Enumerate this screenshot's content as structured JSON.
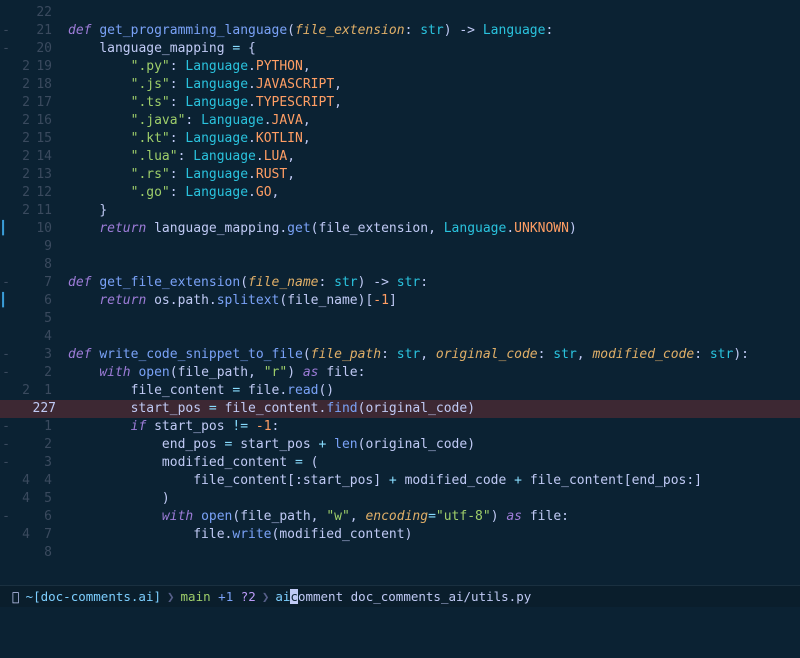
{
  "lines": [
    {
      "sign": "",
      "rel": "22",
      "abs": "",
      "tokens": []
    },
    {
      "sign": "-",
      "rel": "21",
      "abs": "",
      "tokens": [
        {
          "t": "kw",
          "v": "def "
        },
        {
          "t": "fnname",
          "v": "get_programming_language"
        },
        {
          "t": "punc",
          "v": "("
        },
        {
          "t": "param",
          "v": "file_extension"
        },
        {
          "t": "punc",
          "v": ": "
        },
        {
          "t": "type",
          "v": "str"
        },
        {
          "t": "punc",
          "v": ") -> "
        },
        {
          "t": "type",
          "v": "Language"
        },
        {
          "t": "punc",
          "v": ":"
        }
      ]
    },
    {
      "sign": "-",
      "rel": "20",
      "abs": "",
      "indent": 1,
      "tokens": [
        {
          "t": "var",
          "v": "language_mapping "
        },
        {
          "t": "op",
          "v": "= "
        },
        {
          "t": "punc",
          "v": "{"
        },
        {
          "t": "",
          "v": ""
        }
      ]
    },
    {
      "sign": "",
      "rel": "19",
      "abs": "2",
      "indent": 2,
      "tokens": [
        {
          "t": "str",
          "v": "\".py\""
        },
        {
          "t": "punc",
          "v": ": "
        },
        {
          "t": "type",
          "v": "Language"
        },
        {
          "t": "punc",
          "v": "."
        },
        {
          "t": "enum",
          "v": "PYTHON"
        },
        {
          "t": "punc",
          "v": ","
        }
      ]
    },
    {
      "sign": "",
      "rel": "18",
      "abs": "2",
      "indent": 2,
      "tokens": [
        {
          "t": "str",
          "v": "\".js\""
        },
        {
          "t": "punc",
          "v": ": "
        },
        {
          "t": "type",
          "v": "Language"
        },
        {
          "t": "punc",
          "v": "."
        },
        {
          "t": "enum",
          "v": "JAVASCRIPT"
        },
        {
          "t": "punc",
          "v": ","
        }
      ]
    },
    {
      "sign": "",
      "rel": "17",
      "abs": "2",
      "indent": 2,
      "tokens": [
        {
          "t": "str",
          "v": "\".ts\""
        },
        {
          "t": "punc",
          "v": ": "
        },
        {
          "t": "type",
          "v": "Language"
        },
        {
          "t": "punc",
          "v": "."
        },
        {
          "t": "enum",
          "v": "TYPESCRIPT"
        },
        {
          "t": "punc",
          "v": ","
        }
      ]
    },
    {
      "sign": "",
      "rel": "16",
      "abs": "2",
      "indent": 2,
      "tokens": [
        {
          "t": "str",
          "v": "\".java\""
        },
        {
          "t": "punc",
          "v": ": "
        },
        {
          "t": "type",
          "v": "Language"
        },
        {
          "t": "punc",
          "v": "."
        },
        {
          "t": "enum",
          "v": "JAVA"
        },
        {
          "t": "punc",
          "v": ","
        }
      ]
    },
    {
      "sign": "",
      "rel": "15",
      "abs": "2",
      "indent": 2,
      "tokens": [
        {
          "t": "str",
          "v": "\".kt\""
        },
        {
          "t": "punc",
          "v": ": "
        },
        {
          "t": "type",
          "v": "Language"
        },
        {
          "t": "punc",
          "v": "."
        },
        {
          "t": "enum",
          "v": "KOTLIN"
        },
        {
          "t": "punc",
          "v": ","
        }
      ]
    },
    {
      "sign": "",
      "rel": "14",
      "abs": "2",
      "indent": 2,
      "tokens": [
        {
          "t": "str",
          "v": "\".lua\""
        },
        {
          "t": "punc",
          "v": ": "
        },
        {
          "t": "type",
          "v": "Language"
        },
        {
          "t": "punc",
          "v": "."
        },
        {
          "t": "enum",
          "v": "LUA"
        },
        {
          "t": "punc",
          "v": ","
        }
      ]
    },
    {
      "sign": "",
      "rel": "13",
      "abs": "2",
      "indent": 2,
      "tokens": [
        {
          "t": "str",
          "v": "\".rs\""
        },
        {
          "t": "punc",
          "v": ": "
        },
        {
          "t": "type",
          "v": "Language"
        },
        {
          "t": "punc",
          "v": "."
        },
        {
          "t": "enum",
          "v": "RUST"
        },
        {
          "t": "punc",
          "v": ","
        }
      ]
    },
    {
      "sign": "",
      "rel": "12",
      "abs": "2",
      "indent": 2,
      "tokens": [
        {
          "t": "str",
          "v": "\".go\""
        },
        {
          "t": "punc",
          "v": ": "
        },
        {
          "t": "type",
          "v": "Language"
        },
        {
          "t": "punc",
          "v": "."
        },
        {
          "t": "enum",
          "v": "GO"
        },
        {
          "t": "punc",
          "v": ","
        }
      ]
    },
    {
      "sign": "",
      "rel": "11",
      "abs": "2",
      "indent": 1,
      "tokens": [
        {
          "t": "punc",
          "v": "}"
        }
      ]
    },
    {
      "sign": "bar",
      "rel": "10",
      "abs": "",
      "indent": 1,
      "tokens": [
        {
          "t": "kw",
          "v": "return "
        },
        {
          "t": "var",
          "v": "language_mapping"
        },
        {
          "t": "punc",
          "v": "."
        },
        {
          "t": "fn",
          "v": "get"
        },
        {
          "t": "punc",
          "v": "("
        },
        {
          "t": "var",
          "v": "file_extension"
        },
        {
          "t": "punc",
          "v": ", "
        },
        {
          "t": "type",
          "v": "Language"
        },
        {
          "t": "punc",
          "v": "."
        },
        {
          "t": "enum",
          "v": "UNKNOWN"
        },
        {
          "t": "punc",
          "v": ")"
        }
      ]
    },
    {
      "sign": "",
      "rel": "9",
      "abs": "",
      "tokens": []
    },
    {
      "sign": "",
      "rel": "8",
      "abs": "",
      "tokens": []
    },
    {
      "sign": "-",
      "rel": "7",
      "abs": "",
      "tokens": [
        {
          "t": "kw",
          "v": "def "
        },
        {
          "t": "fnname",
          "v": "get_file_extension"
        },
        {
          "t": "punc",
          "v": "("
        },
        {
          "t": "param",
          "v": "file_name"
        },
        {
          "t": "punc",
          "v": ": "
        },
        {
          "t": "type",
          "v": "str"
        },
        {
          "t": "punc",
          "v": ") -> "
        },
        {
          "t": "type",
          "v": "str"
        },
        {
          "t": "punc",
          "v": ":"
        }
      ]
    },
    {
      "sign": "bar",
      "rel": "6",
      "abs": "",
      "indent": 1,
      "tokens": [
        {
          "t": "kw",
          "v": "return "
        },
        {
          "t": "var",
          "v": "os"
        },
        {
          "t": "punc",
          "v": "."
        },
        {
          "t": "var",
          "v": "path"
        },
        {
          "t": "punc",
          "v": "."
        },
        {
          "t": "fn",
          "v": "splitext"
        },
        {
          "t": "punc",
          "v": "("
        },
        {
          "t": "var",
          "v": "file_name"
        },
        {
          "t": "punc",
          "v": ")["
        },
        {
          "t": "num",
          "v": "-1"
        },
        {
          "t": "punc",
          "v": "]"
        }
      ]
    },
    {
      "sign": "",
      "rel": "5",
      "abs": "",
      "tokens": []
    },
    {
      "sign": "",
      "rel": "4",
      "abs": "",
      "tokens": []
    },
    {
      "sign": "-",
      "rel": "3",
      "abs": "",
      "tokens": [
        {
          "t": "kw",
          "v": "def "
        },
        {
          "t": "fnname",
          "v": "write_code_snippet_to_file"
        },
        {
          "t": "punc",
          "v": "("
        },
        {
          "t": "param",
          "v": "file_path"
        },
        {
          "t": "punc",
          "v": ": "
        },
        {
          "t": "type",
          "v": "str"
        },
        {
          "t": "punc",
          "v": ", "
        },
        {
          "t": "param",
          "v": "original_code"
        },
        {
          "t": "punc",
          "v": ": "
        },
        {
          "t": "type",
          "v": "str"
        },
        {
          "t": "punc",
          "v": ", "
        },
        {
          "t": "param",
          "v": "modified_code"
        },
        {
          "t": "punc",
          "v": ": "
        },
        {
          "t": "type",
          "v": "str"
        },
        {
          "t": "punc",
          "v": "):"
        }
      ]
    },
    {
      "sign": "-",
      "rel": "2",
      "abs": "",
      "indent": 1,
      "tokens": [
        {
          "t": "kw",
          "v": "with "
        },
        {
          "t": "fn",
          "v": "open"
        },
        {
          "t": "punc",
          "v": "("
        },
        {
          "t": "var",
          "v": "file_path"
        },
        {
          "t": "punc",
          "v": ", "
        },
        {
          "t": "str",
          "v": "\"r\""
        },
        {
          "t": "punc",
          "v": ") "
        },
        {
          "t": "kw",
          "v": "as "
        },
        {
          "t": "var",
          "v": "file"
        },
        {
          "t": "punc",
          "v": ":"
        }
      ]
    },
    {
      "sign": "",
      "rel": "1",
      "abs": "2",
      "indent": 2,
      "tokens": [
        {
          "t": "var",
          "v": "file_content "
        },
        {
          "t": "op",
          "v": "= "
        },
        {
          "t": "var",
          "v": "file"
        },
        {
          "t": "punc",
          "v": "."
        },
        {
          "t": "fn",
          "v": "read"
        },
        {
          "t": "punc",
          "v": "()"
        }
      ]
    },
    {
      "sign": "",
      "rel": "227",
      "abs": "",
      "cur": true,
      "hl": true,
      "indent": 2,
      "tokens": [
        {
          "t": "var",
          "v": "start_pos "
        },
        {
          "t": "op",
          "v": "= "
        },
        {
          "t": "var",
          "v": "file_content"
        },
        {
          "t": "punc",
          "v": "."
        },
        {
          "t": "fn",
          "v": "find"
        },
        {
          "t": "punc",
          "v": "("
        },
        {
          "t": "var",
          "v": "original_code"
        },
        {
          "t": "punc",
          "v": ")"
        }
      ]
    },
    {
      "sign": "-",
      "rel": "1",
      "abs": "",
      "indent": 2,
      "tokens": [
        {
          "t": "kw",
          "v": "if "
        },
        {
          "t": "var",
          "v": "start_pos "
        },
        {
          "t": "op",
          "v": "!= "
        },
        {
          "t": "num",
          "v": "-1"
        },
        {
          "t": "punc",
          "v": ":"
        }
      ]
    },
    {
      "sign": "-",
      "rel": "2",
      "abs": "",
      "indent": 3,
      "tokens": [
        {
          "t": "var",
          "v": "end_pos "
        },
        {
          "t": "op",
          "v": "= "
        },
        {
          "t": "var",
          "v": "start_pos "
        },
        {
          "t": "op",
          "v": "+ "
        },
        {
          "t": "fn",
          "v": "len"
        },
        {
          "t": "punc",
          "v": "("
        },
        {
          "t": "var",
          "v": "original_code"
        },
        {
          "t": "punc",
          "v": ")"
        }
      ]
    },
    {
      "sign": "-",
      "rel": "3",
      "abs": "",
      "indent": 3,
      "tokens": [
        {
          "t": "var",
          "v": "modified_content "
        },
        {
          "t": "op",
          "v": "= "
        },
        {
          "t": "punc",
          "v": "("
        }
      ]
    },
    {
      "sign": "",
      "rel": "4",
      "abs": "4",
      "indent": 4,
      "tokens": [
        {
          "t": "var",
          "v": "file_content"
        },
        {
          "t": "punc",
          "v": "[:"
        },
        {
          "t": "var",
          "v": "start_pos"
        },
        {
          "t": "punc",
          "v": "] "
        },
        {
          "t": "op",
          "v": "+ "
        },
        {
          "t": "var",
          "v": "modified_code "
        },
        {
          "t": "op",
          "v": "+ "
        },
        {
          "t": "var",
          "v": "file_content"
        },
        {
          "t": "punc",
          "v": "["
        },
        {
          "t": "var",
          "v": "end_pos"
        },
        {
          "t": "punc",
          "v": ":]"
        }
      ]
    },
    {
      "sign": "",
      "rel": "5",
      "abs": "4",
      "indent": 3,
      "tokens": [
        {
          "t": "punc",
          "v": ")"
        }
      ]
    },
    {
      "sign": "-",
      "rel": "6",
      "abs": "",
      "indent": 3,
      "tokens": [
        {
          "t": "kw",
          "v": "with "
        },
        {
          "t": "fn",
          "v": "open"
        },
        {
          "t": "punc",
          "v": "("
        },
        {
          "t": "var",
          "v": "file_path"
        },
        {
          "t": "punc",
          "v": ", "
        },
        {
          "t": "str",
          "v": "\"w\""
        },
        {
          "t": "punc",
          "v": ", "
        },
        {
          "t": "param",
          "v": "encoding"
        },
        {
          "t": "op",
          "v": "="
        },
        {
          "t": "str",
          "v": "\"utf-8\""
        },
        {
          "t": "punc",
          "v": ") "
        },
        {
          "t": "kw",
          "v": "as "
        },
        {
          "t": "var",
          "v": "file"
        },
        {
          "t": "punc",
          "v": ":"
        }
      ]
    },
    {
      "sign": "",
      "rel": "7",
      "abs": "4",
      "indent": 4,
      "tokens": [
        {
          "t": "var",
          "v": "file"
        },
        {
          "t": "punc",
          "v": "."
        },
        {
          "t": "fn",
          "v": "write"
        },
        {
          "t": "punc",
          "v": "("
        },
        {
          "t": "var",
          "v": "modified_content"
        },
        {
          "t": "punc",
          "v": ")"
        }
      ]
    },
    {
      "sign": "",
      "rel": "8",
      "abs": "",
      "tokens": []
    }
  ],
  "statusbar": {
    "apple": "",
    "fish": "󰈺",
    "tilde": "~",
    "path": "[doc-comments.ai]",
    "chev": "❯",
    "git_icon": "",
    "branch_icon": "",
    "branch": "main",
    "plus": "+1",
    "q": "?2",
    "ai": "ai",
    "cursor": "c",
    "cmd": "omment",
    "arg": "doc_comments_ai/utils.py"
  }
}
